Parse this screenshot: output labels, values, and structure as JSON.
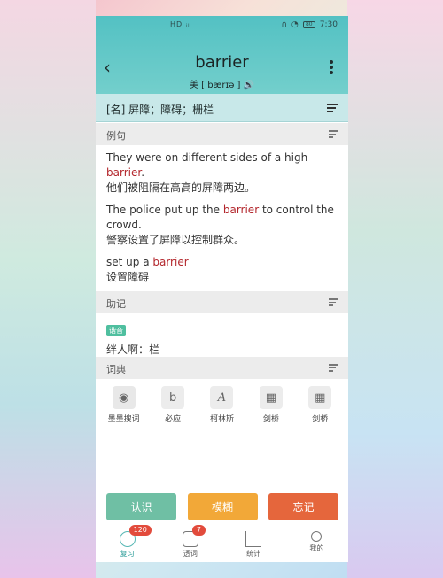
{
  "status": {
    "center": "HD ᵢₗ",
    "time": "7:30",
    "battery": "80"
  },
  "word": {
    "title": "barrier",
    "phonetic": "美 [ bærɪə ] 🔊"
  },
  "definition": "[名] 屏障；障碍；栅栏",
  "sections": {
    "examples": "例句",
    "mnemonic": "助记",
    "dictionary": "词典"
  },
  "examples": [
    {
      "en_before": "They were on different sides of a high ",
      "hl": "barrier",
      "en_after": ".",
      "zh": "他们被阻隔在高高的屏障两边。"
    },
    {
      "en_before": "The police put up the ",
      "hl": "barrier",
      "en_after": " to control the crowd.",
      "zh": "警察设置了屏障以控制群众。"
    },
    {
      "en_before": "set up a ",
      "hl": "barrier",
      "en_after": "",
      "zh": "设置障碍"
    }
  ],
  "mnemonic": {
    "badge": "谐音",
    "text": "绊人啊：栏"
  },
  "dictionaries": [
    {
      "label": "墨墨搜词",
      "icon": "owl-icon"
    },
    {
      "label": "必应",
      "icon": "bing-icon"
    },
    {
      "label": "柯林斯",
      "icon": "collins-icon"
    },
    {
      "label": "剑桥",
      "icon": "cambridge-icon"
    },
    {
      "label": "剑桥",
      "icon": "cambridge-icon"
    }
  ],
  "actions": {
    "know": "认识",
    "vague": "模糊",
    "forget": "忘记"
  },
  "colors": {
    "know": "#6fbfa4",
    "vague": "#f2a838",
    "forget": "#e5663c",
    "header": "#53c1c3"
  },
  "tabs": [
    {
      "label": "复习",
      "badge": "120"
    },
    {
      "label": "透词",
      "badge": "7"
    },
    {
      "label": "统计",
      "badge": ""
    },
    {
      "label": "我的",
      "badge": ""
    }
  ]
}
